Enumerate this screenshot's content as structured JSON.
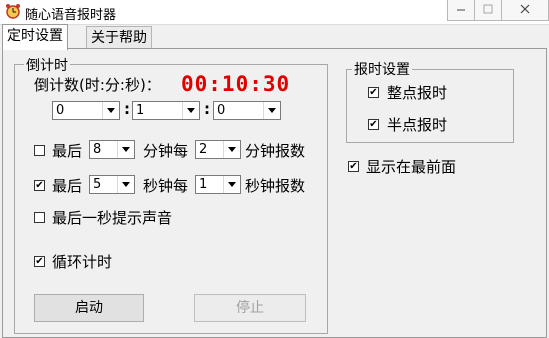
{
  "window": {
    "title": "随心语音报时器",
    "accent_color": "#e00000"
  },
  "tabs": [
    {
      "label": "定时设置",
      "active": true
    },
    {
      "label": "关于帮助",
      "active": false
    }
  ],
  "countdown": {
    "group_label": "倒计时",
    "label": "倒计数(时:分:秒)：",
    "display": "00:10:30",
    "hours": "0",
    "minutes": "1",
    "seconds": "0",
    "colon": ":",
    "last_minutes": {
      "checked": false,
      "prefix": "最后",
      "value": "8",
      "middle": "分钟每",
      "interval": "2",
      "suffix": "分钟报数"
    },
    "last_seconds": {
      "checked": true,
      "prefix": "最后",
      "value": "5",
      "middle": "秒钟每",
      "interval": "1",
      "suffix": "秒钟报数"
    },
    "last_second_sound": {
      "checked": false,
      "label": "最后一秒提示声音"
    },
    "loop": {
      "checked": true,
      "label": "循环计时"
    },
    "start_label": "启动",
    "stop_label": "停止"
  },
  "report": {
    "group_label": "报时设置",
    "hourly": {
      "checked": true,
      "label": "整点报时"
    },
    "half_hour": {
      "checked": true,
      "label": "半点报时"
    }
  },
  "topmost": {
    "checked": true,
    "label": "显示在最前面"
  }
}
